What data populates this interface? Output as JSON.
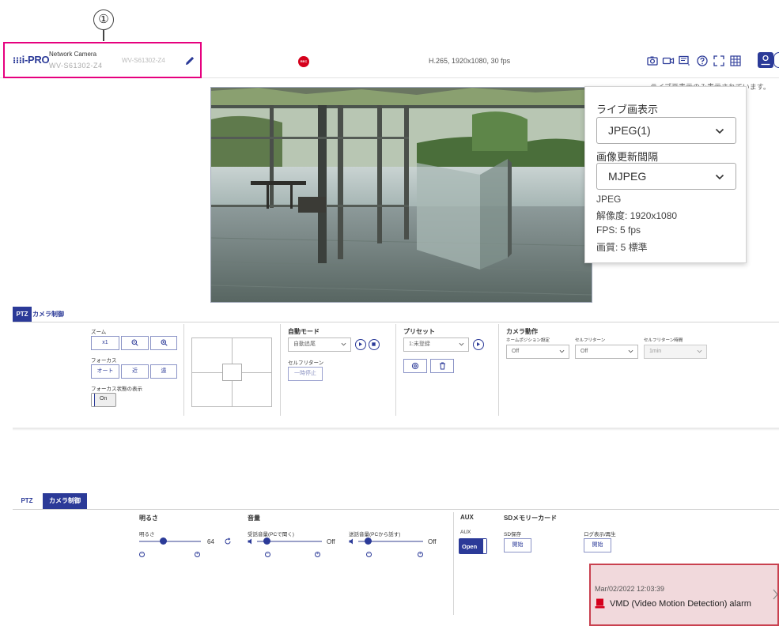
{
  "callout": {
    "number": "①"
  },
  "header": {
    "logo_text": "i-PRO",
    "product_type": "Network Camera",
    "model_number": "WV-S61302-Z4",
    "model_number_secondary": "WV-S61302-Z4",
    "stream_info": "H.265, 1920x1080, 30 fps",
    "rec_label": "REC",
    "top_text": "ライブ画表示のみ表示されています。"
  },
  "dropdown": {
    "live_label": "ライブ画表示",
    "live_value": "JPEG(1)",
    "refresh_label": "画像更新間隔",
    "refresh_value": "MJPEG",
    "info_format": "JPEG",
    "info_resolution": "解像度: 1920x1080",
    "info_fps": "FPS: 5 fps",
    "info_quality": "画質: 5 標準"
  },
  "ptz_panel": {
    "tab_ptz": "PTZ",
    "tab_camera": "カメラ制御",
    "zoom_label": "ズーム",
    "zoom_x1": "x1",
    "focus_label": "フォーカス",
    "focus_auto": "オート",
    "focus_near": "近",
    "focus_far": "遠",
    "focus_display_label": "フォーカス状態の表示",
    "focus_display_value": "On",
    "auto_mode_title": "自動モード",
    "auto_mode_value": "自動追尾",
    "self_return_label": "セルフリターン",
    "pause_button": "一時停止",
    "preset_title": "プリセット",
    "preset_value": "1:未登録",
    "camera_action_title": "カメラ動作",
    "home_position_label": "ホームポジション設定",
    "home_position_value": "Off",
    "self_return_label2": "セルフリターン",
    "self_return_value": "Off",
    "self_return_time_label": "セルフリターン時間",
    "self_return_time_value": "1min"
  },
  "camera_panel": {
    "tab_ptz": "PTZ",
    "tab_camera": "カメラ制御",
    "brightness_title": "明るさ",
    "brightness_label": "明るさ",
    "brightness_value": "64",
    "brightness_level": 0.38,
    "audio_title": "音量",
    "receive_label": "受話音量(PCで聞く)",
    "receive_value": "Off",
    "transmit_label": "送話音量(PCから話す)",
    "transmit_value": "Off",
    "aux_title": "AUX",
    "aux_label": "AUX",
    "aux_value": "Open",
    "sd_title": "SDメモリーカード",
    "sd_save_label": "SD保存",
    "sd_save_button": "開始",
    "log_label": "ログ表示/再生",
    "log_button": "開始"
  },
  "alarm": {
    "timestamp": "Mar/02/2022 12:03:39",
    "message": "VMD (Video Motion Detection) alarm"
  },
  "colors": {
    "brand": "#2b3a98",
    "highlight": "#e6007e",
    "rec": "#d5001c",
    "alarm_border": "#c9414f",
    "alarm_bg": "#f1d9dc"
  }
}
